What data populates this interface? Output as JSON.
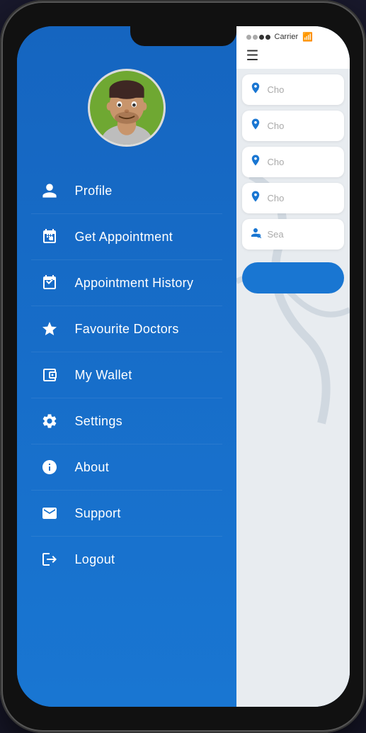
{
  "phone": {
    "statusBar": {
      "signal_dots": 4,
      "active_dots": 2,
      "carrier": "Carrier",
      "wifi_symbol": "⌾"
    },
    "hamburger": "☰"
  },
  "drawer": {
    "menuItems": [
      {
        "id": "profile",
        "icon": "person",
        "label": "Profile"
      },
      {
        "id": "get-appointment",
        "icon": "calendar-plus",
        "label": "Get Appointment"
      },
      {
        "id": "appointment-history",
        "icon": "calendar-check",
        "label": "Appointment History"
      },
      {
        "id": "favourite-doctors",
        "icon": "star",
        "label": "Favourite Doctors"
      },
      {
        "id": "my-wallet",
        "icon": "wallet",
        "label": "My Wallet"
      },
      {
        "id": "settings",
        "icon": "gear",
        "label": "Settings"
      },
      {
        "id": "about",
        "icon": "info",
        "label": "About"
      },
      {
        "id": "support",
        "icon": "envelope",
        "label": "Support"
      },
      {
        "id": "logout",
        "icon": "logout",
        "label": "Logout"
      }
    ]
  },
  "content": {
    "rows": [
      {
        "icon": "🏥",
        "placeholder": "Cho"
      },
      {
        "icon": "📍",
        "placeholder": "Cho"
      },
      {
        "icon": "📍",
        "placeholder": "Cho"
      },
      {
        "icon": "👨‍⚕️",
        "placeholder": "Cho"
      },
      {
        "icon": "🔍",
        "placeholder": "Sea"
      }
    ],
    "button_label": ""
  }
}
